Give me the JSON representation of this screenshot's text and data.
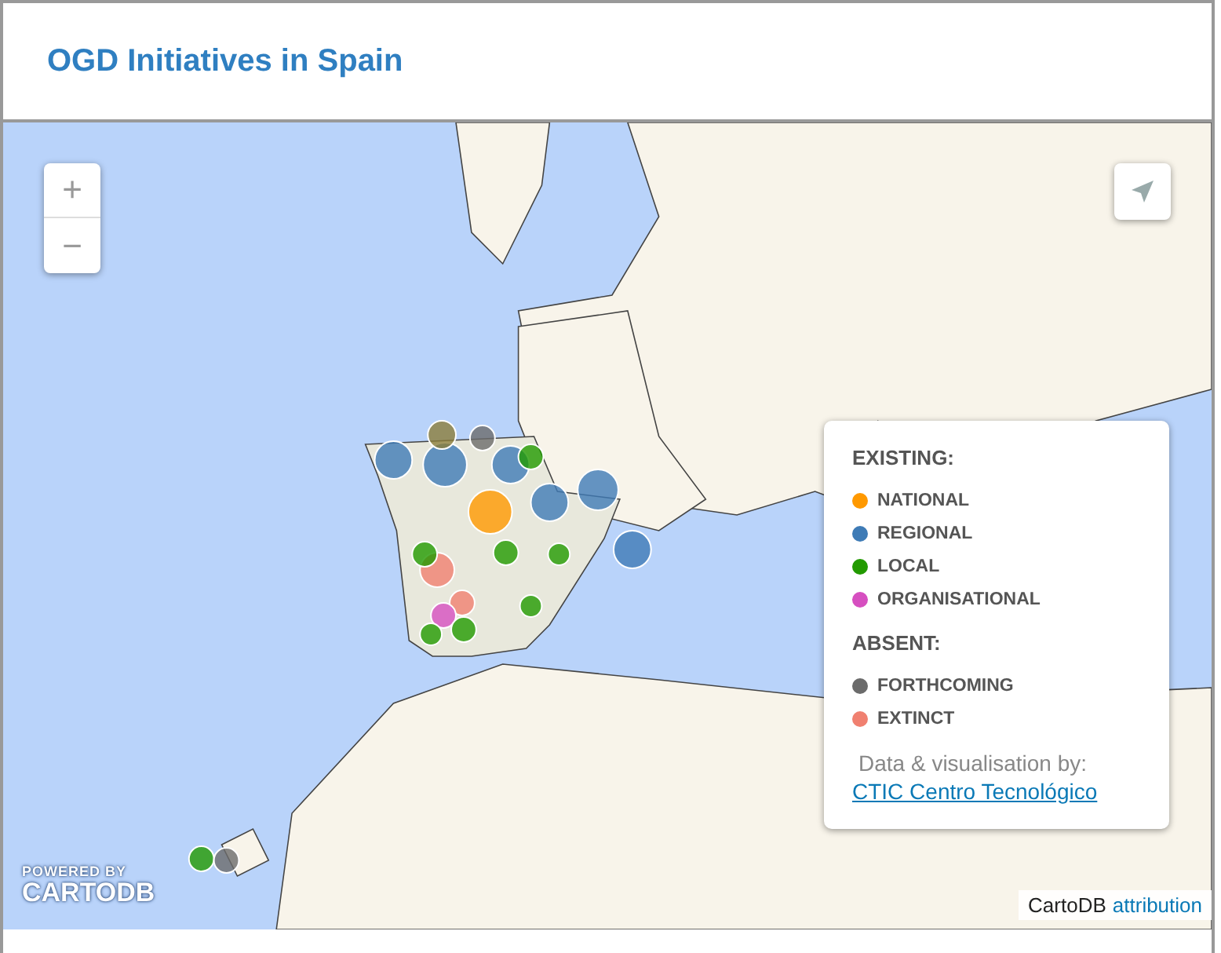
{
  "header": {
    "title": "OGD Initiatives in Spain"
  },
  "map": {
    "zoom_in": "+",
    "zoom_out": "−"
  },
  "legend": {
    "sections": [
      {
        "title": "EXISTING:",
        "items": [
          {
            "label": "NATIONAL",
            "color": "#ff9900"
          },
          {
            "label": "REGIONAL",
            "color": "#3e7bb6"
          },
          {
            "label": "LOCAL",
            "color": "#229a00"
          },
          {
            "label": "ORGANISATIONAL",
            "color": "#d64fc0"
          }
        ]
      },
      {
        "title": "ABSENT:",
        "items": [
          {
            "label": "FORTHCOMING",
            "color": "#6b6b6b"
          },
          {
            "label": "EXTINCT",
            "color": "#f08070"
          }
        ]
      }
    ],
    "credit": "Data & visualisation by:",
    "link": "CTIC Centro Tecnológico"
  },
  "logo": {
    "tagline": "POWERED BY",
    "name": "CARTODB"
  },
  "attribution": {
    "text": "CartoDB",
    "link": "attribution"
  }
}
